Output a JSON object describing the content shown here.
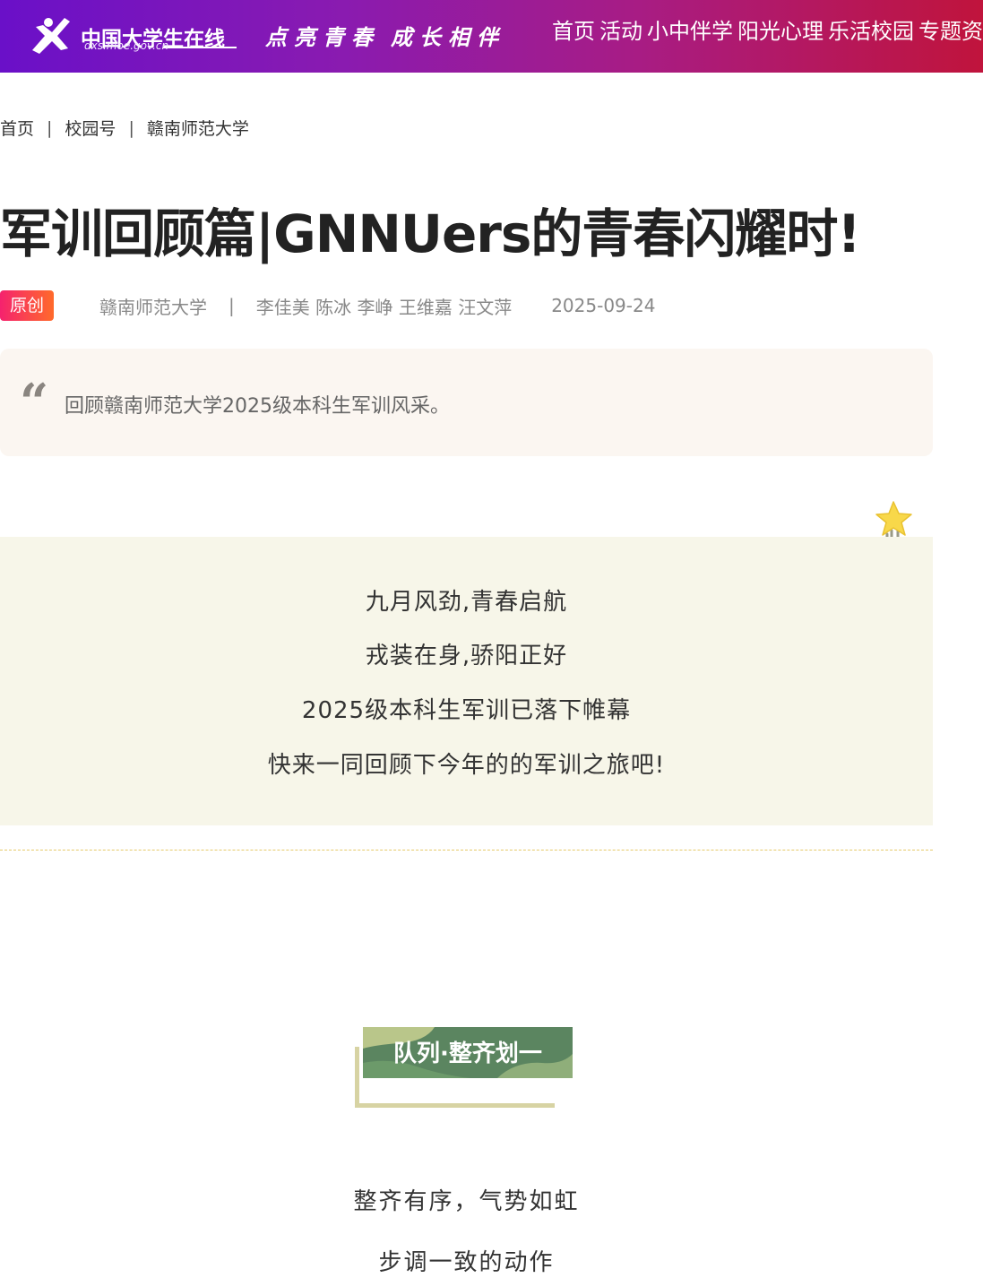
{
  "header": {
    "logo_title": "中国大学生在线",
    "logo_url": "dxs.moe.gov.cn",
    "slogan_1": "点亮青春",
    "slogan_2": "成长相伴",
    "nav": [
      "首页",
      "活动",
      "小中伴学",
      "阳光心理",
      "乐活校园",
      "专题资"
    ],
    "gradient_colors": [
      "#6a10c8",
      "#c0143c"
    ]
  },
  "breadcrumb": {
    "items": [
      "首页",
      "校园号",
      "赣南师范大学"
    ],
    "separator": "|"
  },
  "article": {
    "title": "军训回顾篇|GNNUers的青春闪耀时!",
    "badge": "原创",
    "source": "赣南师范大学",
    "meta_separator": "|",
    "authors": "李佳美 陈冰 李峥 王维嘉 汪文萍",
    "date": "2025-09-24",
    "abstract": "回顾赣南师范大学2025级本科生军训风采。",
    "intro_lines": [
      "九月风劲,青春启航",
      "戎装在身,骄阳正好",
      "2025级本科生军训已落下帷幕",
      "快来一同回顾下今年的的军训之旅吧!"
    ],
    "section_title": "队列·整齐划一",
    "body_lines": [
      "整齐有序，气势如虹",
      "步调一致的动作"
    ]
  },
  "colors": {
    "badge_gradient": [
      "#f5226e",
      "#ff6a2b"
    ],
    "abstract_bg": "#fbf6f1",
    "intro_bg": "#f7f6e9",
    "section_green": "#5b8560",
    "section_bracket": "#d7d3a3",
    "dashed_line": "#e6c96a"
  },
  "icons": {
    "logo": "running-person-logo",
    "quote": "quote-icon",
    "pin": "star-paperclip-icon"
  }
}
